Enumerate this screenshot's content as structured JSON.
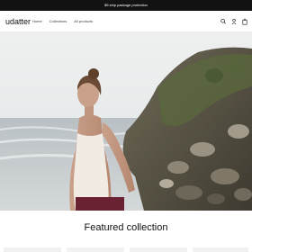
{
  "announcement": {
    "text": "$5 ship package protection"
  },
  "header": {
    "logo": "udatter",
    "nav": [
      "Home",
      "Collections",
      "All products"
    ],
    "icons": [
      "search-icon",
      "account-icon",
      "cart-icon"
    ]
  },
  "hero": {
    "image": "woman-on-rocky-beach"
  },
  "featured": {
    "title": "Featured collection",
    "card_count": 4
  },
  "colors": {
    "announcement_bg": "#121212",
    "text": "#121212",
    "card_bg": "#f1f1f1"
  }
}
